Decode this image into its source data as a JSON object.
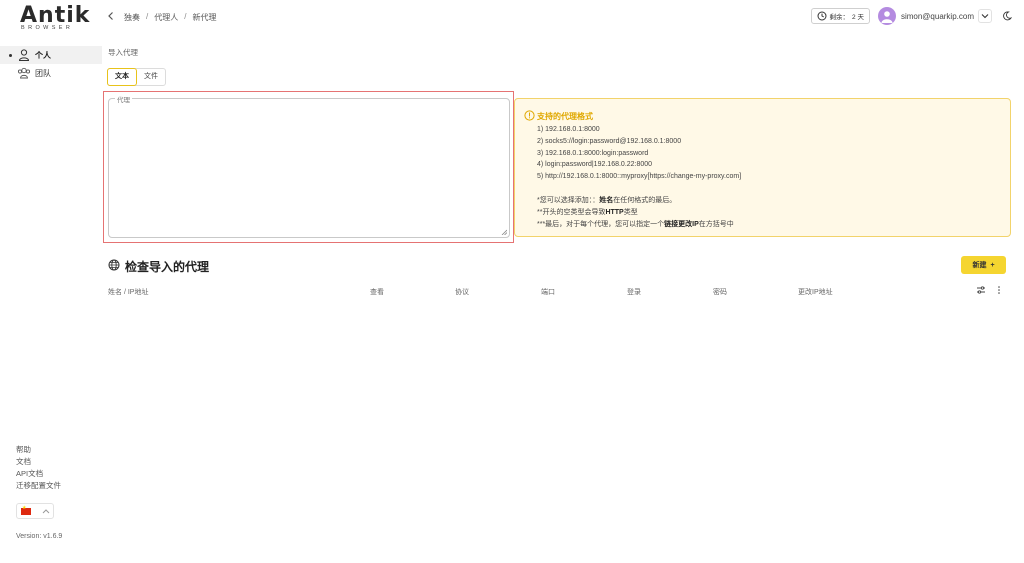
{
  "logo": {
    "main": "Antik",
    "sub": "BROWSER"
  },
  "sidebar": {
    "items": [
      {
        "label": "个人",
        "icon": "user-icon",
        "active": true
      },
      {
        "label": "团队",
        "icon": "team-icon",
        "active": false
      }
    ],
    "links": [
      "帮助",
      "文档",
      "API文档",
      "迁移配置文件"
    ],
    "version": "Version: v1.6.9"
  },
  "header": {
    "breadcrumb": [
      "独奏",
      "代理人",
      "新代理"
    ],
    "timer_label": "剩余：",
    "timer_value": "2 天",
    "user_email": "simon@quarkip.com"
  },
  "main": {
    "section_title": "导入代理",
    "tabs": [
      {
        "label": "文本",
        "active": true
      },
      {
        "label": "文件",
        "active": false
      }
    ],
    "proxy_field": {
      "legend": "代理",
      "value": ""
    },
    "info": {
      "title": "支持的代理格式",
      "formats": [
        "1) 192.168.0.1:8000",
        "2) socks5://login:password@192.168.0.1:8000",
        "3) 192.168.0.1:8000:login:password",
        "4) login:password|192.168.0.22:8000",
        "5) http://192.168.0.1:8000::myproxy[https://change-my-proxy.com]"
      ],
      "note1_pre": "*您可以选择添加：：",
      "note1_bold": "姓名",
      "note1_post": "在任何格式的最后。",
      "note2_pre": "**开头的空类型会导致",
      "note2_bold": "HTTP",
      "note2_post": "类型",
      "note3_pre": "***最后，对于每个代理，您可以指定一个",
      "note3_bold": "链接更改IP",
      "note3_post": "在方括号中"
    },
    "check_title": "检查导入的代理",
    "new_button": "新建",
    "table_headers": [
      "姓名 / IP地址",
      "查看",
      "协议",
      "端口",
      "登录",
      "密码",
      "更改IP地址"
    ]
  },
  "colors": {
    "accent": "#f5d530",
    "highlight_border": "#e57373",
    "info_bg": "#fff9e7"
  }
}
